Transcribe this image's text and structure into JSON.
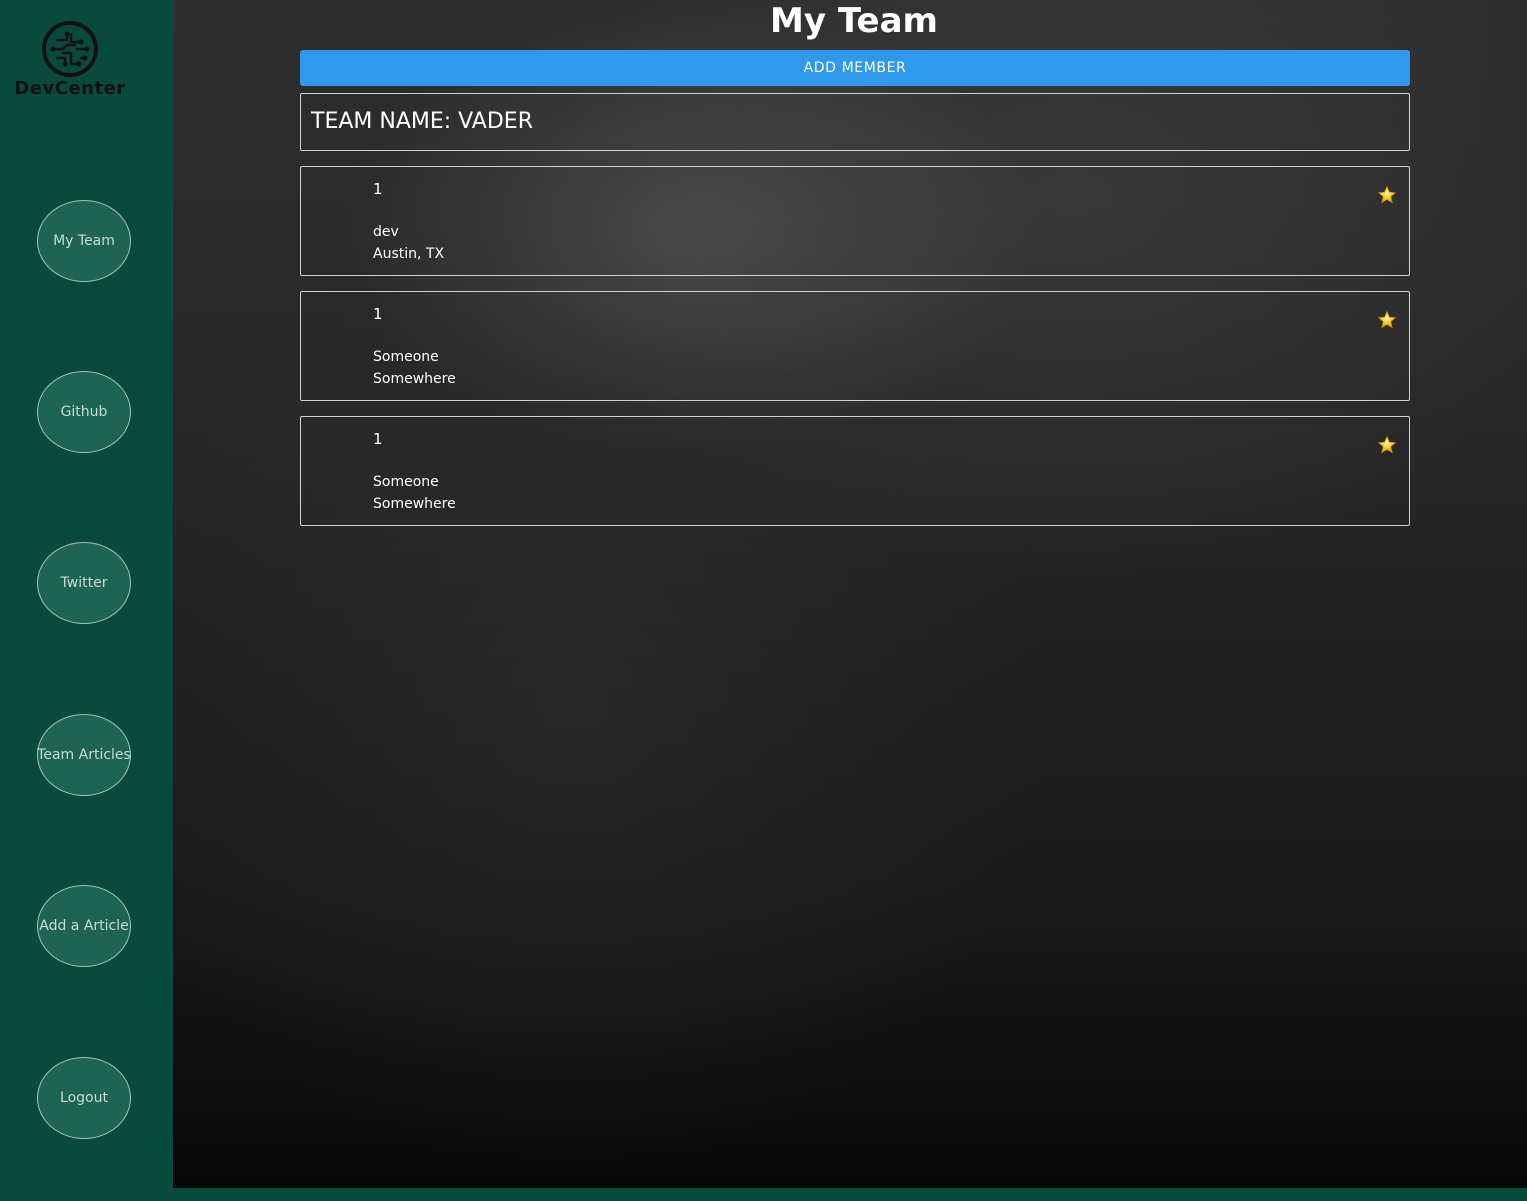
{
  "app": {
    "logo_text": "DevCenter"
  },
  "sidebar": {
    "items": [
      {
        "label": "My Team"
      },
      {
        "label": "Github"
      },
      {
        "label": "Twitter"
      },
      {
        "label": "Team Articles"
      },
      {
        "label": "Add a Article"
      },
      {
        "label": "Logout"
      }
    ]
  },
  "main": {
    "title": "My Team",
    "add_member_label": "ADD MEMBER",
    "team_name": "TEAM NAME: VADER",
    "members": [
      {
        "number": "1",
        "name": "dev",
        "location": "Austin, TX"
      },
      {
        "number": "1",
        "name": "Someone",
        "location": "Somewhere"
      },
      {
        "number": "1",
        "name": "Someone",
        "location": "Somewhere"
      }
    ]
  },
  "colors": {
    "sidebar_bg": "#0a4a3c",
    "nav_button_bg": "#1d6453",
    "accent_blue": "#3099ee",
    "star_yellow": "#f5c518"
  },
  "icons": {
    "logo": "circuit-brain-icon",
    "favorite": "star-icon"
  }
}
